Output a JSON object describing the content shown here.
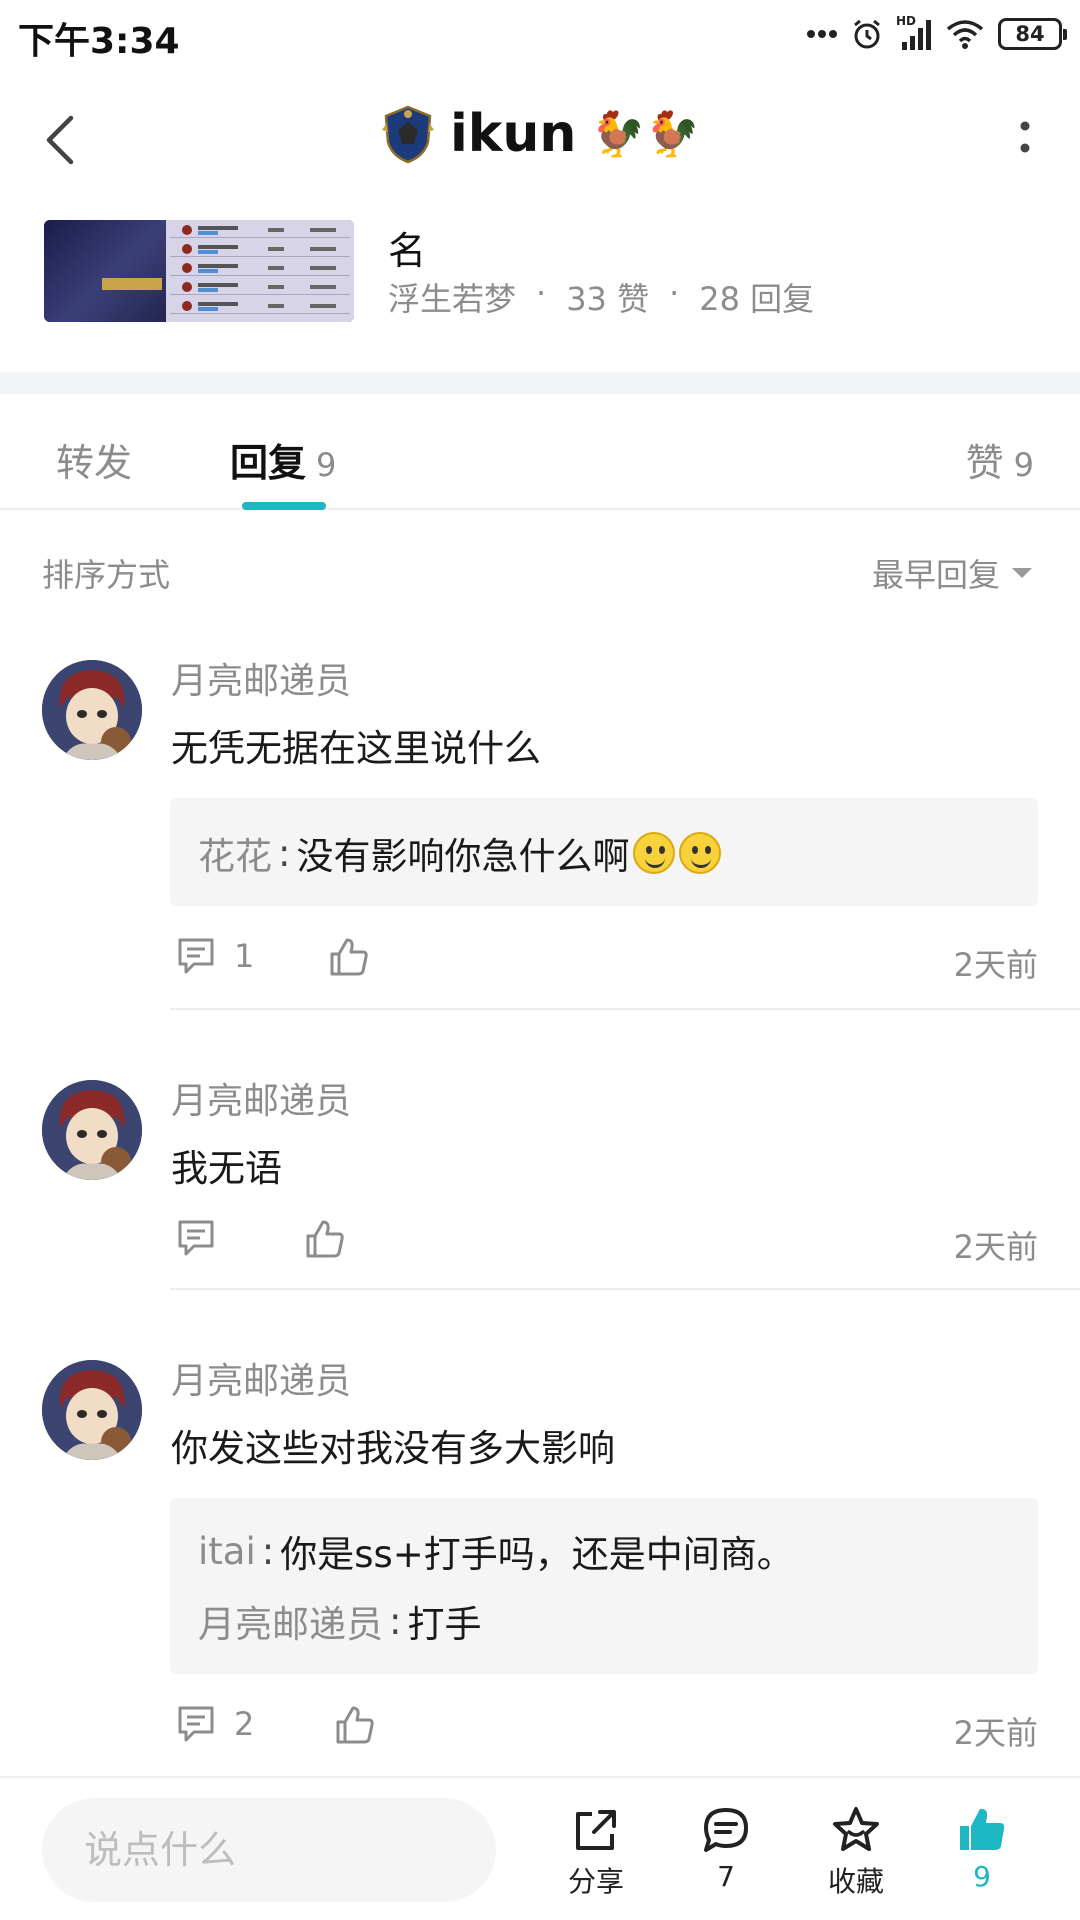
{
  "status_bar": {
    "time": "下午3:34",
    "hd_label": "HD",
    "battery_level": "84"
  },
  "header": {
    "title": "ikun",
    "decor": "🐓🐓"
  },
  "post": {
    "title": "名",
    "author": "浮生若梦",
    "sep1": "·",
    "likes": "33 赞",
    "sep2": "·",
    "replies": "28 回复"
  },
  "tabs": {
    "forward": {
      "label": "转发"
    },
    "reply": {
      "label": "回复",
      "count": "9"
    },
    "like": {
      "label": "赞",
      "count": "9"
    }
  },
  "sort": {
    "label": "排序方式",
    "value": "最早回复"
  },
  "comments": [
    {
      "author": "月亮邮递员",
      "text": "无凭无据在这里说什么",
      "quotes": [
        {
          "name": "花花",
          "sep": ":",
          "text": "没有影响你急什么啊"
        }
      ],
      "reply_count": "1",
      "time": "2天前"
    },
    {
      "author": "月亮邮递员",
      "text": "我无语",
      "quotes": [],
      "reply_count": "",
      "time": "2天前"
    },
    {
      "author": "月亮邮递员",
      "text": "你发这些对我没有多大影响",
      "quotes": [
        {
          "name": "itai",
          "sep": ":",
          "text": "你是ss+打手吗，还是中间商。"
        },
        {
          "name": "月亮邮递员",
          "sep": ":",
          "text": "打手"
        }
      ],
      "reply_count": "2",
      "time": "2天前"
    }
  ],
  "bottom_bar": {
    "input_placeholder": "说点什么",
    "share_label": "分享",
    "comment_count": "7",
    "favorite_label": "收藏",
    "like_count": "9",
    "accent_color": "#1eb8c2"
  }
}
